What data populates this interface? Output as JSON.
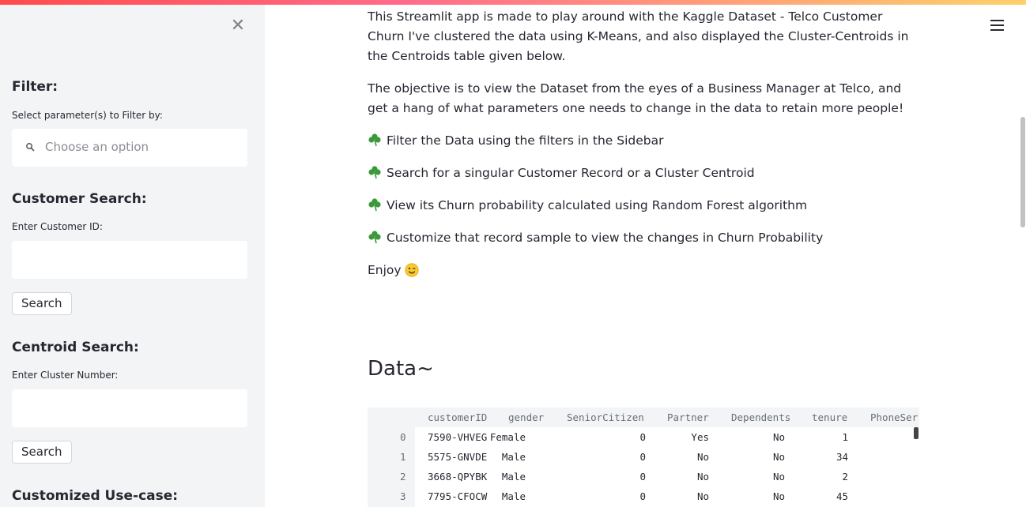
{
  "sidebar": {
    "close_symbol": "✕",
    "filter": {
      "heading": "Filter:",
      "label": "Select parameter(s) to Filter by:",
      "placeholder": "Choose an option"
    },
    "customer_search": {
      "heading": "Customer Search:",
      "label": "Enter Customer ID:",
      "value": "",
      "button": "Search"
    },
    "centroid_search": {
      "heading": "Centroid Search:",
      "label": "Enter Cluster Number:",
      "value": "",
      "button": "Search"
    },
    "customized": {
      "heading": "Customized Use-case:"
    }
  },
  "main": {
    "intro_1": "This Streamlit app is made to play around with the Kaggle Dataset - Telco Customer Churn I've clustered the data using K-Means, and also displayed the Cluster-Centroids in the Centroids table given below.",
    "intro_2": "The objective is to view the Dataset from the eyes of a Business Manager at Telco, and get a hang of what parameters one needs to change in the data to retain more people!",
    "bullets": [
      "Filter the Data using the filters in the Sidebar",
      "Search for a singular Customer Record or a Cluster Centroid",
      "View its Churn probability calculated using Random Forest algorithm",
      "Customize that record sample to view the changes in Churn Probability"
    ],
    "enjoy": "Enjoy",
    "data_heading": "Data~"
  },
  "table": {
    "columns": [
      "customerID",
      "gender",
      "SeniorCitizen",
      "Partner",
      "Dependents",
      "tenure",
      "PhoneSer"
    ],
    "rows": [
      {
        "index": "0",
        "cells": [
          "7590-VHVEG",
          "Female",
          "0",
          "Yes",
          "No",
          "1",
          ""
        ]
      },
      {
        "index": "1",
        "cells": [
          "5575-GNVDE",
          "Male",
          "0",
          "No",
          "No",
          "34",
          ""
        ]
      },
      {
        "index": "2",
        "cells": [
          "3668-QPYBK",
          "Male",
          "0",
          "No",
          "No",
          "2",
          ""
        ]
      },
      {
        "index": "3",
        "cells": [
          "7795-CFOCW",
          "Male",
          "0",
          "No",
          "No",
          "45",
          ""
        ]
      }
    ]
  },
  "icons": {
    "close": "close-icon",
    "search": "search-icon",
    "menu": "hamburger-menu-icon",
    "bullet": "shamrock-icon",
    "emoji": "winking-face-icon"
  },
  "colors": {
    "sidebar_bg": "#f3f4f6",
    "text": "#262730",
    "accent_gradient_start": "#ff4b4b",
    "accent_gradient_end": "#ffd16a"
  }
}
